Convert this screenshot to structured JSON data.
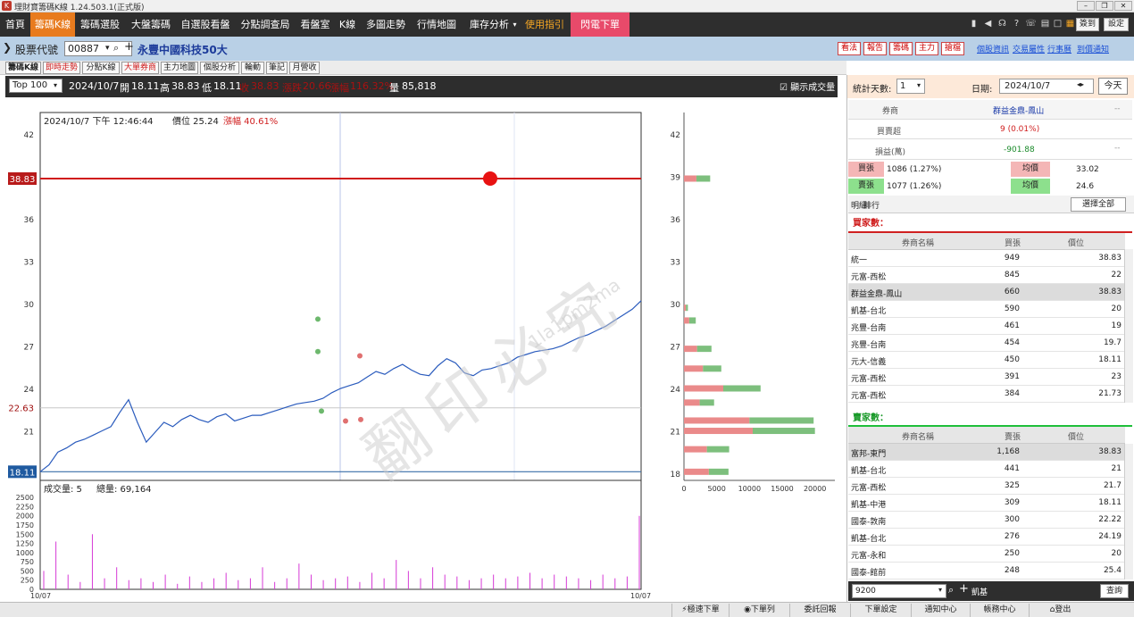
{
  "window": {
    "title": "理財寶籌碼K線 1.24.503.1(正式版)"
  },
  "menu": {
    "items": [
      "首頁",
      "籌碼K線",
      "籌碼選股",
      "大盤籌碼",
      "自選股看盤",
      "分點調查局",
      "看盤室",
      "K線",
      "多圖走勢",
      "行情地圖",
      "庫存分析",
      "使用指引",
      "閃電下單"
    ],
    "active": "籌碼K線",
    "signin": "簽到",
    "settings": "設定"
  },
  "stock": {
    "label": "股票代號",
    "code": "00887",
    "name": "永豐中國科技50大"
  },
  "actions": {
    "red": [
      "看法",
      "報告",
      "籌碼",
      "主力",
      "搶檔"
    ],
    "links": [
      "個股資訊",
      "交易屬性",
      "行事曆",
      "到價通知"
    ]
  },
  "tabs": [
    "籌碼K線",
    "即時走勢",
    "分點K線",
    "大單券商",
    "主力地圖",
    "個股分析",
    "輪動",
    "筆記",
    "月營收"
  ],
  "info": {
    "select": "Top 100",
    "date": "2024/10/7",
    "open_label": "開",
    "open": "18.11",
    "high_label": "高",
    "high": "38.83",
    "low_label": "低",
    "low": "18.11",
    "close_label": "收",
    "close": "38.83",
    "change_label": "漲跌",
    "change": "20.66",
    "pct_label": "漲幅",
    "pct": "116.32%",
    "vol_label": "量",
    "volume": "85,818",
    "show_volume": "顯示成交量"
  },
  "chart_data": [
    {
      "type": "line",
      "title": "2024/10/7 下午 12:46:44 價位 25.24 漲幅 40.61%",
      "time_label": "2024/10/7 下午 12:46:44",
      "price_label": "價位 25.24",
      "pct_label": "漲幅 40.61%",
      "yticks": [
        21,
        24,
        27,
        30,
        33,
        36,
        39,
        42
      ],
      "ylim": [
        17.5,
        43.5
      ],
      "high": 38.83,
      "low": 18.11,
      "ref": 22.63,
      "xticks": [
        "10/07",
        "10/07"
      ],
      "series": [
        {
          "values": [
            18.11,
            18.6,
            19.5,
            19.8,
            20.2,
            20.4,
            20.7,
            21,
            21.3,
            22.3,
            23.2,
            21.6,
            20.2,
            20.9,
            21.6,
            21.3,
            21.8,
            22.1,
            21.8,
            21.6,
            22,
            22.2,
            21.7,
            21.9,
            22.1,
            22.1,
            22.3,
            22.5,
            22.7,
            22.9,
            23,
            23.1,
            23.3,
            23.7,
            24,
            24.2,
            24.4,
            24.8,
            25.2,
            25,
            25.4,
            25.7,
            25.3,
            25,
            24.9,
            25.6,
            26.1,
            25.8,
            25.1,
            24.9,
            25.3,
            25.4,
            25.6,
            25.8,
            26.2,
            26.4,
            26.6,
            26.7,
            26.8,
            27,
            27.3,
            27.6,
            27.8,
            28.1,
            28.4,
            28.8,
            29.2,
            29.6,
            30.2
          ]
        }
      ]
    },
    {
      "type": "bar",
      "title": "",
      "orientation": "horizontal",
      "yticks": [
        18,
        21,
        24,
        27,
        30,
        33,
        36,
        39,
        42
      ],
      "xticks": [
        "0",
        "5000",
        "10000",
        "15000",
        "20000"
      ],
      "xlim": [
        0,
        21000
      ],
      "rows": [
        {
          "price": 18.11,
          "sell": 3800,
          "buy": 3000
        },
        {
          "price": 19.7,
          "sell": 3500,
          "buy": 3400
        },
        {
          "price": 21,
          "sell": 10500,
          "buy": 9500
        },
        {
          "price": 21.73,
          "sell": 10000,
          "buy": 9800
        },
        {
          "price": 23,
          "sell": 2400,
          "buy": 2200
        },
        {
          "price": 24,
          "sell": 6000,
          "buy": 5700
        },
        {
          "price": 25.4,
          "sell": 2900,
          "buy": 2800
        },
        {
          "price": 26.8,
          "sell": 2000,
          "buy": 2200
        },
        {
          "price": 28.8,
          "sell": 800,
          "buy": 1000
        },
        {
          "price": 29.7,
          "sell": 300,
          "buy": 300
        },
        {
          "price": 38.83,
          "sell": 1900,
          "buy": 2100
        }
      ]
    },
    {
      "type": "bar",
      "title": "成交量: 5  總量: 69,164",
      "vol_label": "成交量: 5",
      "total_label": "總量: 69,164",
      "yticks": [
        0,
        250,
        500,
        750,
        1000,
        1250,
        1500,
        1750,
        2000,
        2250,
        2500
      ],
      "ylim": [
        0,
        2600
      ],
      "xticks": [
        "10/07",
        "10/07"
      ],
      "values": [
        500,
        1300,
        400,
        200,
        1500,
        300,
        600,
        250,
        300,
        200,
        400,
        150,
        350,
        200,
        300,
        450,
        250,
        300,
        600,
        200,
        300,
        700,
        400,
        250,
        300,
        350,
        200,
        450,
        300,
        800,
        500,
        300,
        600,
        400,
        350,
        250,
        300,
        400,
        300,
        350,
        450,
        300,
        400,
        350,
        300,
        250,
        400,
        300,
        350,
        2000
      ]
    }
  ],
  "right": {
    "days_label": "統計天數:",
    "days": "1",
    "date_label": "日期:",
    "date": "2024/10/7",
    "today": "今天",
    "broker_label": "券商",
    "broker": "群益金鼎-鳳山",
    "bs_label": "買賣超",
    "bs": "9 (0.01%)",
    "pl_label": "損益(萬)",
    "pl": "-901.88",
    "buy_label": "買張",
    "buy": "1086 (1.27%)",
    "buy_avg_label": "均價",
    "buy_avg": "33.02",
    "sell_label": "賣張",
    "sell": "1077 (1.26%)",
    "sell_avg_label": "均價",
    "sell_avg": "24.6",
    "tab1": "明細",
    "tab2": "排行",
    "select_all": "選擇全部",
    "buyers_title": "買家數：",
    "sellers_title": "賣家數：",
    "cols": [
      "券商名稱",
      "買張",
      "價位"
    ],
    "cols2": [
      "券商名稱",
      "賣張",
      "價位"
    ],
    "buyers": [
      [
        "統一",
        "949",
        "38.83"
      ],
      [
        "元富-西松",
        "845",
        "22"
      ],
      [
        "群益金鼎-鳳山",
        "660",
        "38.83"
      ],
      [
        "凱基-台北",
        "590",
        "20"
      ],
      [
        "兆豐-台南",
        "461",
        "19"
      ],
      [
        "兆豐-台南",
        "454",
        "19.7"
      ],
      [
        "元大-信義",
        "450",
        "18.11"
      ],
      [
        "元富-西松",
        "391",
        "23"
      ],
      [
        "元富-西松",
        "384",
        "21.73"
      ]
    ],
    "sellers": [
      [
        "富邦-東門",
        "1,168",
        "38.83"
      ],
      [
        "凱基-台北",
        "441",
        "21"
      ],
      [
        "元富-西松",
        "325",
        "21.7"
      ],
      [
        "凱基-中港",
        "309",
        "18.11"
      ],
      [
        "國泰-敦南",
        "300",
        "22.22"
      ],
      [
        "凱基-台北",
        "276",
        "24.19"
      ],
      [
        "元富-永和",
        "250",
        "20"
      ],
      [
        "國泰-館前",
        "248",
        "25.4"
      ]
    ],
    "search_code": "9200",
    "search_name": "凱基",
    "search_btn": "查詢"
  },
  "status": {
    "items": [
      "極速下單",
      "下單列",
      "委託回報",
      "下單設定",
      "通知中心",
      "帳務中心",
      "登出"
    ]
  },
  "watermark": "翻印必究",
  "watermark_sub": "1la1pm2ma"
}
